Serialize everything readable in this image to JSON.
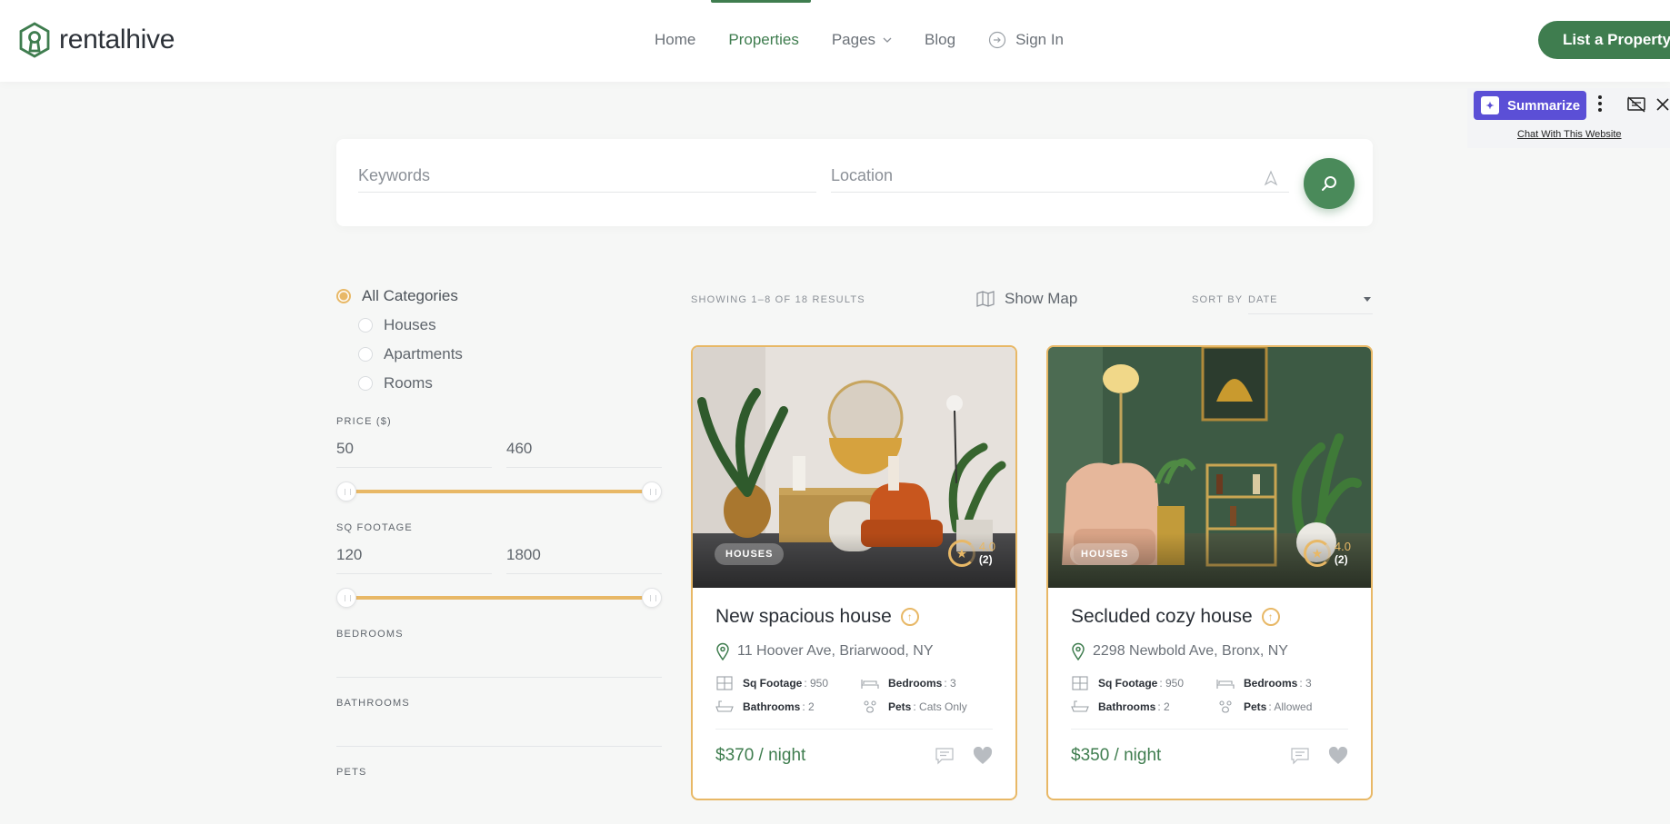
{
  "header": {
    "brand": "rentalhive",
    "nav": [
      {
        "label": "Home"
      },
      {
        "label": "Properties"
      },
      {
        "label": "Pages"
      },
      {
        "label": "Blog"
      },
      {
        "label": "Sign In"
      }
    ],
    "cta": "List a Property"
  },
  "extension": {
    "summarize_label": "Summarize",
    "chat_link": "Chat With This Website"
  },
  "search": {
    "keywords_placeholder": "Keywords",
    "location_placeholder": "Location"
  },
  "filters": {
    "categories": [
      "All Categories",
      "Houses",
      "Apartments",
      "Rooms"
    ],
    "selected_category": "All Categories",
    "price_label": "PRICE ($)",
    "price_min": "50",
    "price_max": "460",
    "sqft_label": "SQ FOOTAGE",
    "sqft_min": "120",
    "sqft_max": "1800",
    "bedrooms_label": "BEDROOMS",
    "bathrooms_label": "BATHROOMS",
    "pets_label": "PETS"
  },
  "results": {
    "count_text": "SHOWING 1–8 OF 18 RESULTS",
    "show_map": "Show Map",
    "sort_label": "SORT BY",
    "sort_value": "DATE"
  },
  "listings": [
    {
      "category": "HOUSES",
      "rating": "4.0",
      "reviews": "(2)",
      "title": "New spacious house",
      "address": "11 Hoover Ave, Briarwood, NY",
      "sqft_label": "Sq Footage",
      "sqft": ": 950",
      "bedrooms_label": "Bedrooms",
      "bedrooms": ": 3",
      "bathrooms_label": "Bathrooms",
      "bathrooms": ": 2",
      "pets_label": "Pets",
      "pets": ": Cats Only",
      "price": "$370 / night"
    },
    {
      "category": "HOUSES",
      "rating": "4.0",
      "reviews": "(2)",
      "title": "Secluded cozy house",
      "address": "2298 Newbold Ave, Bronx, NY",
      "sqft_label": "Sq Footage",
      "sqft": ": 950",
      "bedrooms_label": "Bedrooms",
      "bedrooms": ": 3",
      "bathrooms_label": "Bathrooms",
      "bathrooms": ": 2",
      "pets_label": "Pets",
      "pets": ": Allowed",
      "price": "$350 / night"
    }
  ],
  "colors": {
    "brand_green": "#3f7d4f",
    "accent_gold": "#e8b866",
    "extension_purple": "#5b4fd6"
  }
}
